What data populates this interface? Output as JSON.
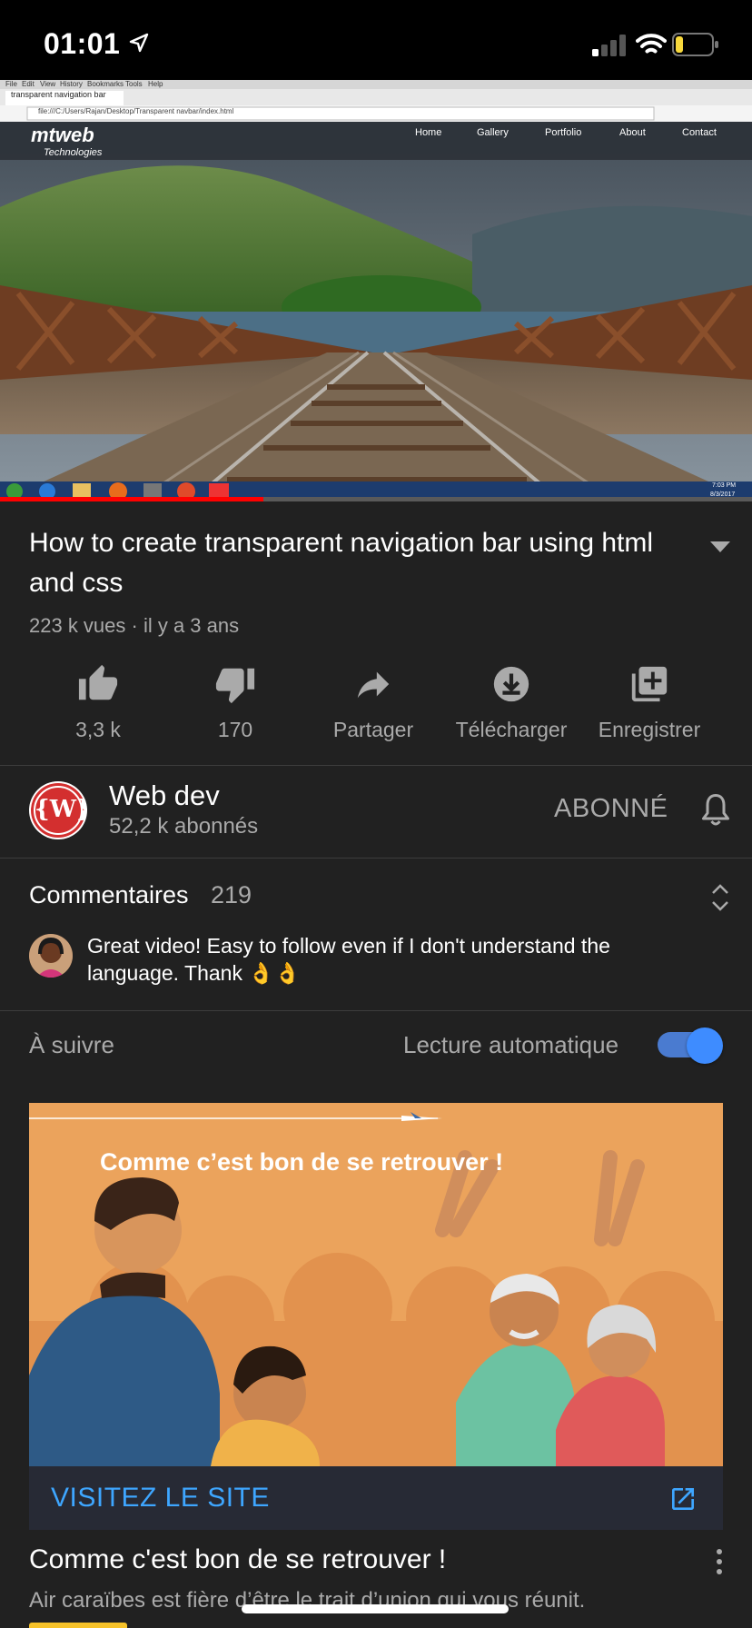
{
  "status_bar": {
    "time": "01:01",
    "battery_color": "#f7d83c"
  },
  "video": {
    "browser_tab": "transparent navigation bar",
    "browser_url": "file:///C:/Users/Rajan/Desktop/Transparent navbar/index.html",
    "browser_menu": [
      "File",
      "Edit",
      "View",
      "History",
      "Bookmarks",
      "Tools",
      "Help"
    ],
    "site_logo_main": "mtweb",
    "site_logo_sub": "Technologies",
    "site_nav": [
      "Home",
      "Gallery",
      "Portfolio",
      "About",
      "Contact"
    ],
    "taskbar_clock": "7:03 PM",
    "taskbar_date": "8/3/2017",
    "progress_fraction": 0.35,
    "progress_color": "#ff0000"
  },
  "title": "How to create transparent navigation bar using html and css",
  "meta": "223 k vues · il y a 3 ans",
  "actions": {
    "like": "3,3 k",
    "dislike": "170",
    "share": "Partager",
    "download": "Télécharger",
    "save": "Enregistrer"
  },
  "channel": {
    "name": "Web dev",
    "subscribers": "52,2 k abonnés",
    "subscribed_label": "ABONNÉ",
    "avatar_letter": "{W}",
    "avatar_color": "#d32f2f"
  },
  "comments": {
    "title": "Commentaires",
    "count": "219",
    "top_comment": "Great video! Easy to follow even if I don't understand the language. Thank 👌👌"
  },
  "up_next": {
    "label": "À suivre",
    "autoplay_label": "Lecture automatique",
    "autoplay_on": true,
    "accent": "#3e8cff"
  },
  "ad": {
    "image_headline": "Comme c’est bon de se retrouver !",
    "cta": "VISITEZ LE SITE",
    "title": "Comme c'est bon de se retrouver !",
    "description": "Air caraïbes est fière d’être le trait d’union qui vous réunit.",
    "cta_color": "#3ea6ff",
    "background": "#eba35c"
  }
}
